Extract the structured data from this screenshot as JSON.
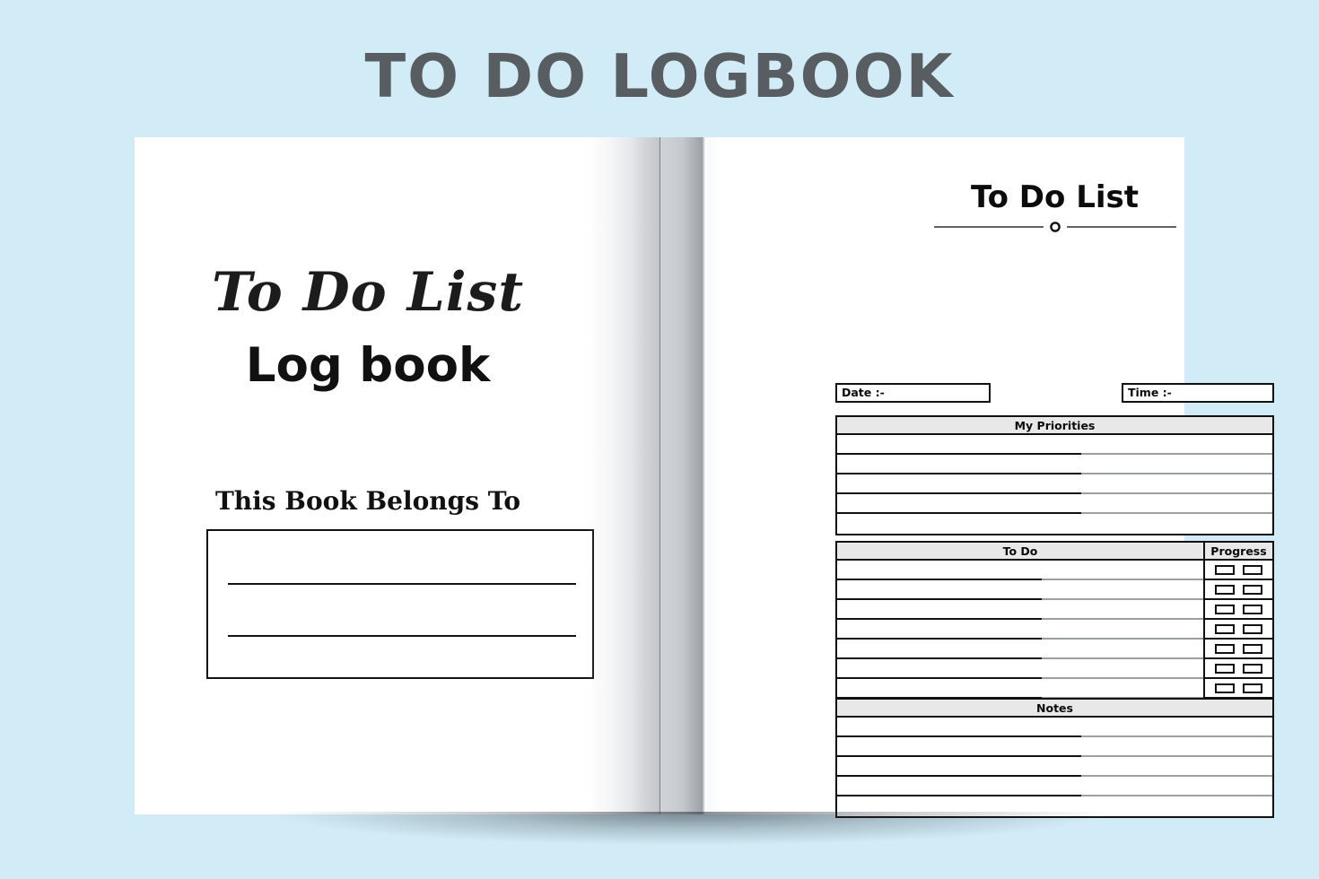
{
  "banner": {
    "title": "TO DO LOGBOOK",
    "title_color": "#585d61",
    "background_color": "#d2ecf7"
  },
  "cover_page": {
    "script_title": "To Do List",
    "subtitle": "Log book",
    "belongs_label": "This Book Belongs To",
    "belongs_lines": [
      "",
      ""
    ]
  },
  "interior_page": {
    "heading": "To Do List",
    "divider_icon": "circle-divider-icon",
    "fields": [
      {
        "label": "Date :-",
        "value": ""
      },
      {
        "label": "Time :-",
        "value": ""
      }
    ],
    "priorities": {
      "header": "My Priorities",
      "header_bg": "#e8e8e8",
      "rows": [
        "",
        "",
        "",
        "",
        ""
      ]
    },
    "todo": {
      "header": "To Do",
      "progress_header": "Progress",
      "header_bg": "#e8e8e8",
      "checkboxes_per_row": 2,
      "rows": [
        "",
        "",
        "",
        "",
        "",
        "",
        "",
        "",
        "",
        "",
        ""
      ]
    },
    "notes": {
      "header": "Notes",
      "header_bg": "#e8e8e8",
      "rows": [
        "",
        "",
        "",
        "",
        ""
      ]
    }
  }
}
